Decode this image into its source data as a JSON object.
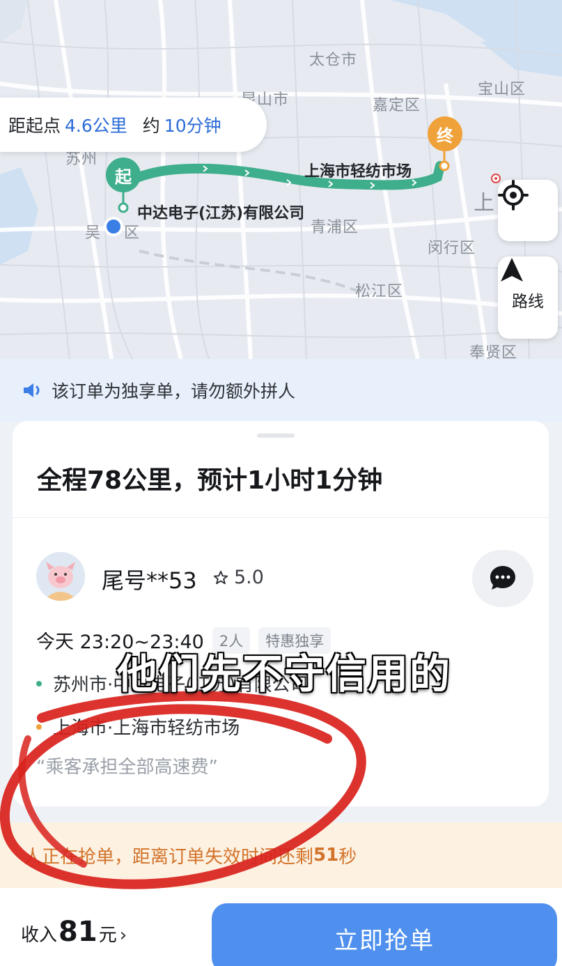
{
  "map": {
    "distance_prefix": "距起点",
    "distance_value": "4.6公里",
    "time_prefix": "约",
    "time_value": "10分钟",
    "start_pin": "起",
    "end_pin": "终",
    "start_place": "中达电子(江苏)有限公司",
    "end_place": "上海市轻纺市场",
    "labels": {
      "taicang": "太仓市",
      "kunshan": "昆山市",
      "jiading": "嘉定区",
      "baoshan": "宝山区",
      "suzhou": "苏州",
      "wu": "吴",
      "wu_qu": "区",
      "qingpu": "青浦区",
      "minhang": "闵行区",
      "songjiang": "松江区",
      "fengxian": "奉贤区",
      "shang": "上"
    },
    "locate_icon": "locate-icon",
    "route_label": "路线",
    "colors": {
      "route": "#3fae8c",
      "start": "#3fae8c",
      "end": "#f0a23a",
      "accent": "#2c6bd8"
    }
  },
  "notice": {
    "icon": "speaker-icon",
    "text": "该订单为独享单，请勿额外拼人"
  },
  "order": {
    "summary": "全程78公里，预计1小时1分钟",
    "passenger_name": "尾号**53",
    "rating": "5.0",
    "time": "今天 23:20~23:40",
    "tags": [
      "2人",
      "特惠独享"
    ],
    "from_address": "苏州市·中达电子(江苏)有限公司",
    "to_address": "上海市·上海市轻纺市场",
    "remark": "“乘客承担全部高速费”"
  },
  "grab_bar": {
    "prefix": "人正在抢单，距离订单失效时间还剩",
    "seconds": "51",
    "suffix": "秒"
  },
  "bottom": {
    "income_label": "收入",
    "income_amount": "81",
    "income_unit": "元",
    "income_chevron": "›",
    "grab_button": "立即抢单"
  },
  "overlay": {
    "caption": "他们先不守信用的"
  }
}
